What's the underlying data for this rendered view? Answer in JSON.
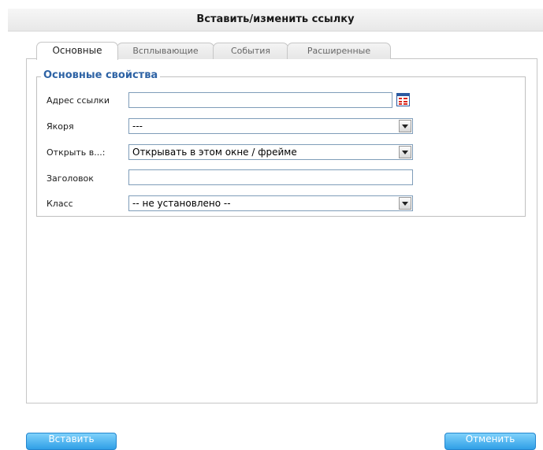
{
  "dialog": {
    "title": "Вставить/изменить ссылку"
  },
  "tabs": [
    {
      "label": "Основные",
      "active": true
    },
    {
      "label": "Всплывающие",
      "active": false
    },
    {
      "label": "События",
      "active": false
    },
    {
      "label": "Расширенные",
      "active": false
    }
  ],
  "section": {
    "legend": "Основные свойства"
  },
  "fields": {
    "href": {
      "label": "Адрес ссылки",
      "value": ""
    },
    "anchors": {
      "label": "Якоря",
      "value": "---"
    },
    "target": {
      "label": "Открыть в...:",
      "value": "Открывать в этом окне / фрейме"
    },
    "title": {
      "label": "Заголовок",
      "value": ""
    },
    "class": {
      "label": "Класс",
      "value": "-- не установлено --"
    }
  },
  "buttons": {
    "insert": "Вставить",
    "cancel": "Отменить"
  },
  "colors": {
    "accent": "#2e63a5",
    "button": "#3aa6ea"
  },
  "icons": {
    "browse": "link-browser-icon",
    "dropdown": "chevron-down-icon"
  }
}
